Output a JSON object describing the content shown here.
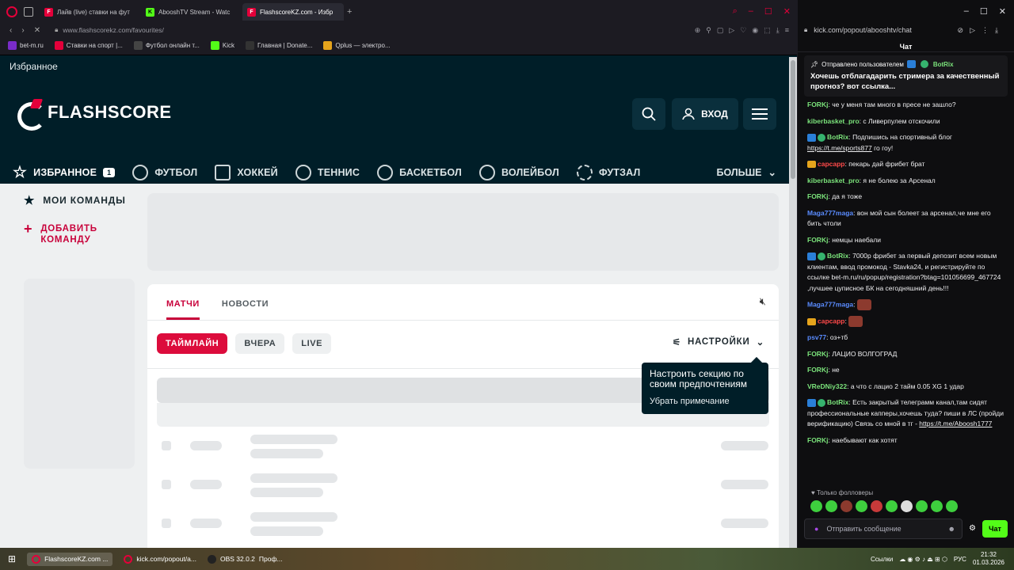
{
  "browser": {
    "tabs": [
      {
        "label": "Лайв (live) ставки на фут",
        "fav": "F",
        "color": "#e4003a"
      },
      {
        "label": "AbooshTV Stream - Watc",
        "fav": "K",
        "color": "#53fc18"
      },
      {
        "label": "FlashscoreKZ.com - Избр",
        "fav": "F",
        "color": "#e4003a"
      }
    ],
    "url": "www.flashscorekz.com/favourites/",
    "bookmarks": [
      "bet-m.ru",
      "Ставки на спорт |...",
      "Футбол онлайн т...",
      "Kick",
      "Главная | Donate...",
      "Qplus — электро..."
    ]
  },
  "site": {
    "breadcrumb": "Избранное",
    "logo": "FLASHSCORE",
    "login": "ВХОД",
    "nav": [
      {
        "label": "ИЗБРАННОЕ",
        "icon": "star-icon"
      },
      {
        "label": "ФУТБОЛ",
        "icon": "soccer-ball-icon"
      },
      {
        "label": "ХОККЕЙ",
        "icon": "hockey-icon"
      },
      {
        "label": "ТЕННИС",
        "icon": "tennis-icon"
      },
      {
        "label": "БАСКЕТБОЛ",
        "icon": "basketball-icon"
      },
      {
        "label": "ВОЛЕЙБОЛ",
        "icon": "volleyball-icon"
      },
      {
        "label": "ФУТЗАЛ",
        "icon": "futsal-icon"
      }
    ],
    "fav_count": "1",
    "more": "БОЛЬШЕ",
    "sidebar": {
      "my_teams": "МОИ КОМАНДЫ",
      "add_team": "ДОБАВИТЬ КОМАНДУ"
    },
    "tabs": [
      "МАТЧИ",
      "НОВОСТИ"
    ],
    "pills": [
      "ТАЙМЛАЙН",
      "ВЧЕРА",
      "LIVE"
    ],
    "settings": "НАСТРОЙКИ",
    "tooltip": {
      "text": "Настроить секцию по своим предпочтениям",
      "dismiss": "Убрать примечание"
    }
  },
  "chat": {
    "url": "kick.com/popout/abooshtv/chat",
    "title": "Чат",
    "pinned": {
      "by": "Отправлено пользователем",
      "user": "BotRix",
      "text": "Хочешь отблагадарить стримера за качественный прогноз? вот ссылка..."
    },
    "messages": [
      {
        "user": "FORKj",
        "color": "#7be37b",
        "text": "че у меня там много в пресе не зашло?"
      },
      {
        "user": "kiberbasket_pro",
        "color": "#7be37b",
        "text": "с Ливерпулем отскочили"
      },
      {
        "user": "BotRix",
        "color": "#7be37b",
        "text": "Подпишись на спортивный блог ",
        "link": "https://t.me/sports877",
        "after": " го гоу!",
        "bot": true
      },
      {
        "user": "capcapp",
        "color": "#ff4a4a",
        "text": "пекарь дай фрибет брат",
        "crown": true
      },
      {
        "user": "kiberbasket_pro",
        "color": "#7be37b",
        "text": "я не болею за Арсенал"
      },
      {
        "user": "FORKj",
        "color": "#7be37b",
        "text": "да я тоже"
      },
      {
        "user": "Maga777maga",
        "color": "#5a8cff",
        "text": "вон мой сын болеет за арсенал,че мне его бить чтоли"
      },
      {
        "user": "FORKj",
        "color": "#7be37b",
        "text": "немцы наебали"
      },
      {
        "user": "BotRix",
        "color": "#7be37b",
        "text": "7000р фрибет за первый депозит всем новым клиентам, ввод промокод - Stavka24, и регистрируйте по ссылке bet-m.ru/ru/popup/registration?btag=101056699_467724 ,лучшее цуписное БК на сегодняшний день!!!",
        "bot": true
      },
      {
        "user": "Maga777maga",
        "color": "#5a8cff",
        "text": "",
        "emote": true
      },
      {
        "user": "capcapp",
        "color": "#ff4a4a",
        "text": "",
        "emote": true,
        "crown": true
      },
      {
        "user": "psv77",
        "color": "#5a8cff",
        "text": "оз+тб"
      },
      {
        "user": "FORKj",
        "color": "#7be37b",
        "text": "ЛАЦИО ВОЛГОГРАД"
      },
      {
        "user": "FORKj",
        "color": "#7be37b",
        "text": "не"
      },
      {
        "user": "VReDNiy322",
        "color": "#7be37b",
        "text": "а что с лацио 2 тайм 0.05 XG 1 удар"
      },
      {
        "user": "BotRix",
        "color": "#7be37b",
        "text": "Есть закрытый телеграмм канал,там сидят профессиональные капперы,хочешь туда? пиши в ЛС (пройди верификацию) Связь со мной в тг - ",
        "link": "https://t.me/Aboosh1777",
        "after": "",
        "bot": true
      },
      {
        "user": "FORKj",
        "color": "#7be37b",
        "text": "наебывают как хотят"
      }
    ],
    "followers_only": "Только фолловеры",
    "input_placeholder": "Отправить сообщение",
    "send": "Чат"
  },
  "taskbar": {
    "items": [
      "FlashscoreKZ.com ...",
      "kick.com/popout/a...",
      "OBS 32.0.2",
      "Проф..."
    ],
    "links": "Ссылки",
    "lang": "РУС",
    "time": "21:32",
    "date": "01.03.2026"
  }
}
